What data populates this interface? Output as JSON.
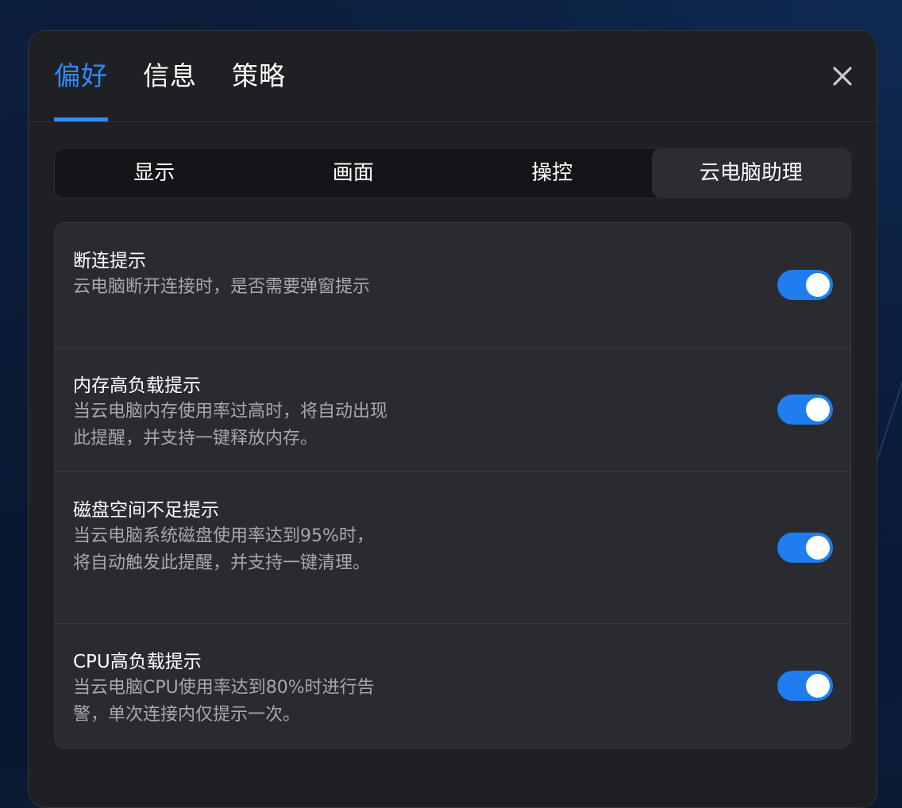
{
  "header": {
    "tabs": [
      {
        "label": "偏好",
        "active": true
      },
      {
        "label": "信息",
        "active": false
      },
      {
        "label": "策略",
        "active": false
      }
    ],
    "close_icon": "close-icon"
  },
  "segments": [
    {
      "label": "显示",
      "active": false
    },
    {
      "label": "画面",
      "active": false
    },
    {
      "label": "操控",
      "active": false
    },
    {
      "label": "云电脑助理",
      "active": true
    }
  ],
  "settings": [
    {
      "title": "断连提示",
      "desc": "云电脑断开连接时，是否需要弹窗提示",
      "enabled": true
    },
    {
      "title": "内存高负载提示",
      "desc": "当云电脑内存使用率过高时，将自动出现此提醒，并支持一键释放内存。",
      "enabled": true
    },
    {
      "title": "磁盘空间不足提示",
      "desc": "当云电脑系统磁盘使用率达到95%时，将自动触发此提醒，并支持一键清理。",
      "enabled": true
    },
    {
      "title": "CPU高负载提示",
      "desc": "当云电脑CPU使用率达到80%时进行告警，单次连接内仅提示一次。",
      "enabled": true
    }
  ],
  "colors": {
    "accent": "#2f8bff",
    "toggle_on": "#1f7df0",
    "panel_bg": "#1f2024",
    "card_bg": "#2a2b30"
  }
}
